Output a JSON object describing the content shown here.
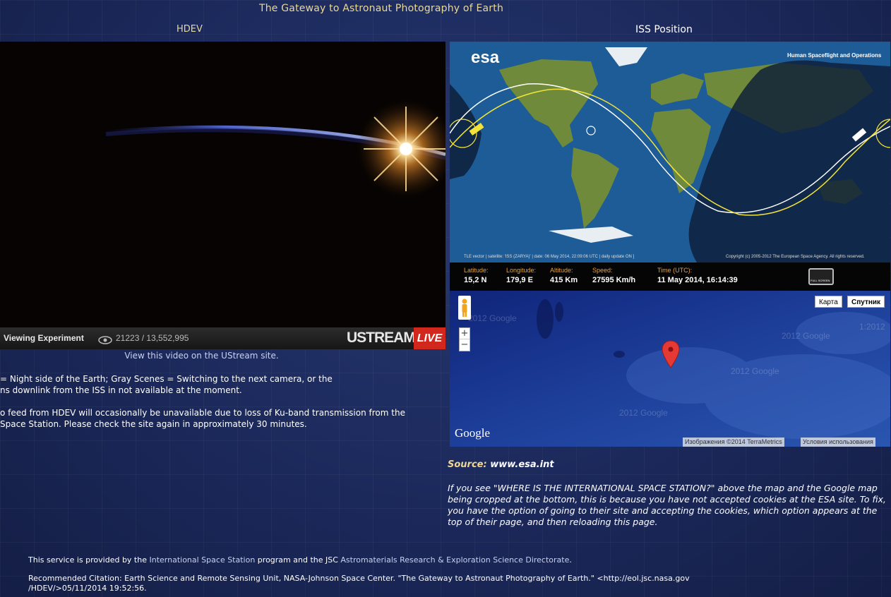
{
  "header": {
    "site_title": "The Gateway to Astronaut Photography of Earth",
    "left_heading": "HDEV",
    "right_heading": "ISS Position"
  },
  "video": {
    "viewing_label": "Viewing Experiment",
    "view_count": "21223 / 13,552,995",
    "ustream_logo": "USTREAM",
    "live_badge": "LIVE",
    "ustream_link_text": "View this video on the UStream site.",
    "note_line_1": "= Night side of the Earth; Gray Scenes = Switching to the next camera, or the",
    "note_line_2": "ns downlink from the ISS in not available at the moment.",
    "note_line_3": "o feed from HDEV will occasionally be unavailable due to loss of Ku-band transmission from the",
    "note_line_4": "Space Station. Please check the site again in approximately 30 minutes."
  },
  "esa_map": {
    "logo": "esa",
    "banner": "Human Spaceflight and Operations",
    "footer_left": "TLE vector | satellite: 'ISS (ZARYA)' | date: 06 May 2014, 22:09:06 UTC | daily update ON ]",
    "footer_right": "Copyright (c) 2005-2012 The European Space Agency. All rights reserved.",
    "fullscreen_label": "FULL SCREEN",
    "info": {
      "latitude_label": "Latitude:",
      "latitude_value": "15,2 N",
      "longitude_label": "Longitude:",
      "longitude_value": "179,9 E",
      "altitude_label": "Altitude:",
      "altitude_value": "415 Km",
      "speed_label": "Speed:",
      "speed_value": "27595 Km/h",
      "time_label": "Time (UTC):",
      "time_value": "11 May 2014, 16:14:39"
    }
  },
  "google_map": {
    "map_button": "Карта",
    "satellite_button": "Спутник",
    "zoom_in": "+",
    "zoom_out": "−",
    "google_logo": "Google",
    "imagery_credit": "Изображения ©2014 TerraMetrics",
    "terms": "Условия использования",
    "watermarks": [
      "2012 Google",
      "2012 Google",
      "2012 Google",
      "2012 Google",
      "1:2012"
    ]
  },
  "source": {
    "label": "Source:",
    "link": "www.esa.int"
  },
  "cookie_note": "If you see \"WHERE IS THE INTERNATIONAL SPACE STATION?\" above the map and the Google map being cropped at the bottom, this is because you have not accepted cookies at the ESA site. To fix, you have the option of going to their site and accepting the cookies, which option appears at the top of their page, and then reloading this page.",
  "footer": {
    "service_prefix": "This service is provided by the ",
    "service_link_1": "International Space Station",
    "service_middle": " program and the JSC ",
    "service_link_2": "Astromaterials Research & Exploration Science Directorate",
    "service_suffix": ".",
    "citation": "Recommended Citation: Earth Science and Remote Sensing Unit, NASA-Johnson Space Center. \"The Gateway to Astronaut Photography of Earth.\" <http://eol.jsc.nasa.gov /HDEV/>05/11/2014 19:52:56."
  },
  "colors": {
    "page_background": "#1a2654",
    "heading_gold": "#e8d89a",
    "info_label_orange": "#f0a030",
    "live_red": "#d2271d",
    "orbit_yellow": "#f2e23a",
    "marker_red": "#e53935"
  }
}
